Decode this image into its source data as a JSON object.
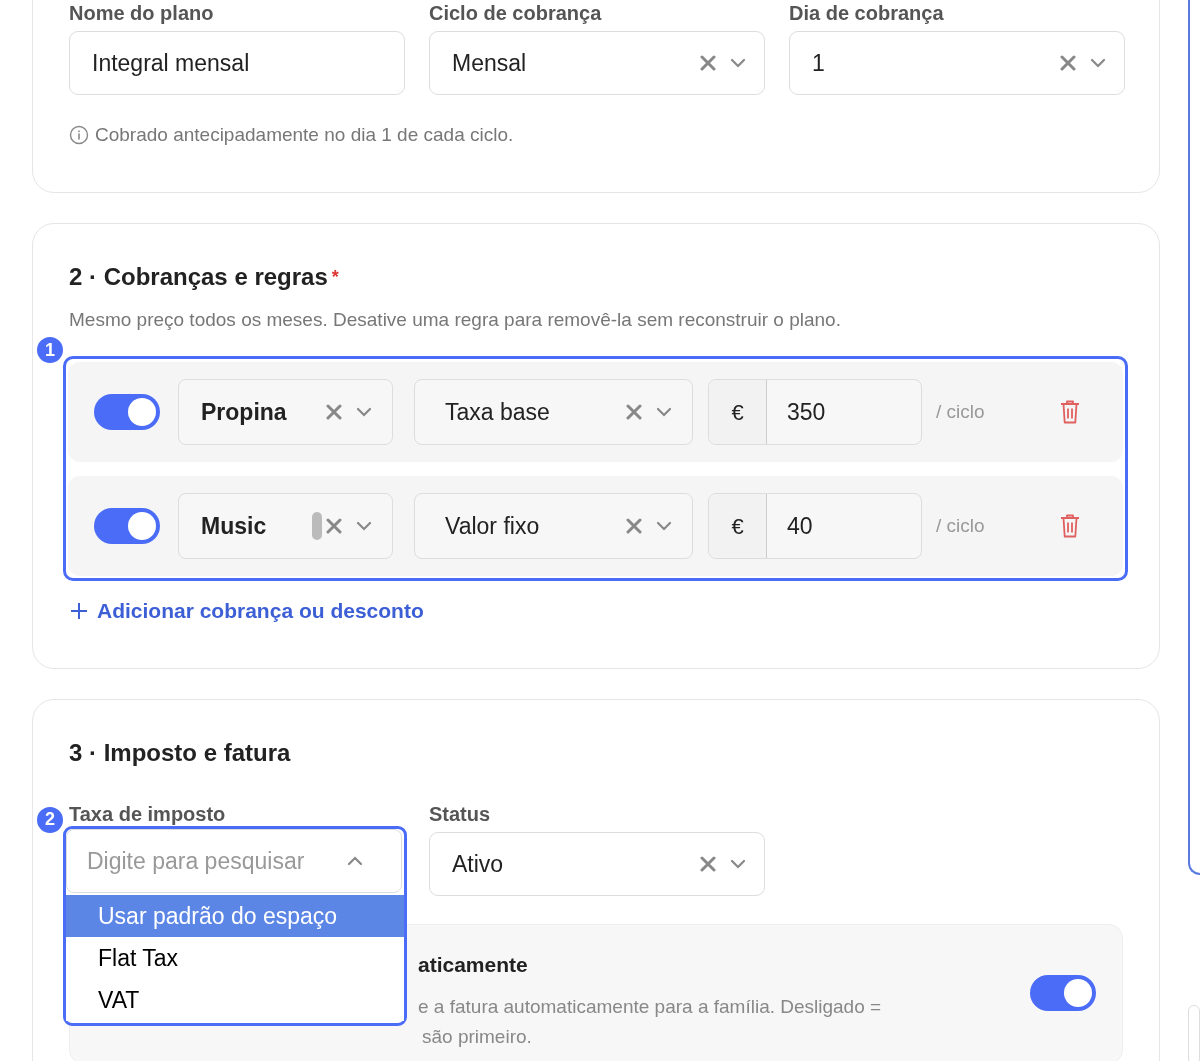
{
  "plan_fields": [
    {
      "label": "Nome do plano",
      "kind": "text",
      "value": "Integral mensal"
    },
    {
      "label": "Ciclo de cobrança",
      "kind": "select",
      "value": "Mensal"
    },
    {
      "label": "Dia de cobrança",
      "kind": "select",
      "value": "1"
    }
  ],
  "plan_hint": "Cobrado antecipadamente no dia 1 de cada ciclo.",
  "charges": {
    "title": "2 · Cobranças e regras",
    "required_mark": "*",
    "description": "Mesmo preço todos os meses. Desative uma regra para removê-la sem reconstruir o plano.",
    "annotation": "1",
    "rules": [
      {
        "enabled": true,
        "item": "Propina",
        "type": "Taxa base",
        "currency": "€",
        "amount": "350",
        "unit": "/ ciclo",
        "scrollbar": false
      },
      {
        "enabled": true,
        "item": "Music",
        "type": "Valor fixo",
        "currency": "€",
        "amount": "40",
        "unit": "/ ciclo",
        "scrollbar": true
      }
    ],
    "add_link": "Adicionar cobrança ou desconto"
  },
  "tax": {
    "title": "3 · Imposto e fatura",
    "annotation": "2",
    "tax_field": {
      "label": "Taxa de imposto",
      "placeholder": "Digite para pesquisar",
      "expanded": true,
      "options": [
        {
          "label": "Usar padrão do espaço",
          "selected": true
        },
        {
          "label": "Flat Tax",
          "selected": false
        },
        {
          "label": "VAT",
          "selected": false
        }
      ]
    },
    "status_field": {
      "label": "Status",
      "value": "Ativo"
    },
    "auto_invoice": {
      "title": "aticamente",
      "description_lines": [
        "e a fatura automaticamente para a família. Desligado =",
        "são primeiro."
      ],
      "on": true
    }
  }
}
